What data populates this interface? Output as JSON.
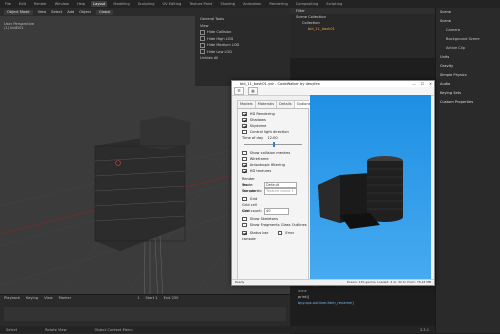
{
  "topbar": {
    "tabs": [
      "File",
      "Edit",
      "Render",
      "Window",
      "Help",
      "Layout",
      "Modeling",
      "Sculpting",
      "UV Editing",
      "Texture Paint",
      "Shading",
      "Animation",
      "Rendering",
      "Compositing",
      "Scripting"
    ],
    "active_index": 5
  },
  "viewport_header": {
    "mode": "Object Mode",
    "view": "View",
    "select": "Select",
    "add": "Add",
    "object": "Object",
    "global": "Global"
  },
  "viewport": {
    "label": "User Perspective",
    "sublabel": "(1) bldEl01"
  },
  "npanel": {
    "rows": [
      "General Tools",
      "View",
      "Hide Collision",
      "Hide High LOD",
      "Hide Medium LOD",
      "Hide Low LOD",
      "Unhide All"
    ]
  },
  "outliner": {
    "search_placeholder": "Filter",
    "rows": [
      "Scene Collection",
      "Collection",
      "bld_11_bash01"
    ]
  },
  "properties": {
    "sections": [
      "Scene",
      "Scene"
    ],
    "rows": [
      "Camera",
      "Background Scene",
      "Active Clip",
      "Units",
      "Gravity",
      "Simple Physics",
      "Audio",
      "Keying Sets",
      "Custom Properties"
    ]
  },
  "timeline": {
    "playback": "Playback",
    "keying": "Keying",
    "view": "View",
    "marker": "Marker",
    "frame": "1",
    "start": "Start 1",
    "end": "End 250"
  },
  "console": {
    "lines": [
      "lead = bpy.context.object",
      ">>> ",
      "print()",
      "bpy.ops.outliner.item_rename()"
    ]
  },
  "statusbar": {
    "items": [
      "Select",
      "Rotate View",
      "Object Context Menu",
      "3.3.1"
    ]
  },
  "window": {
    "title": "bld_11_bash01.ydr - CodeWalker by dexyfex",
    "controls": [
      "—",
      "☐",
      "✕"
    ],
    "toolbar": [
      "☰",
      "▦"
    ],
    "tabs": [
      "Models",
      "Materials",
      "Details",
      "Options"
    ],
    "active_tab": "Options",
    "options": {
      "hd_rendering": {
        "label": "HD Rendering",
        "checked": true
      },
      "shadows": {
        "label": "Shadows",
        "checked": true
      },
      "skydome": {
        "label": "Skydome",
        "checked": true
      },
      "control_light_direction": {
        "label": "Control light direction",
        "checked": false
      },
      "time_of_day_label": "Time of day",
      "time_of_day_value": "12:00",
      "time_of_day_fraction": 0.5,
      "show_collision_meshes": {
        "label": "Show collision meshes",
        "checked": false
      },
      "wireframe": {
        "label": "Wireframe",
        "checked": false
      },
      "anisotropic_filtering": {
        "label": "Anisotropic filtering",
        "checked": true
      },
      "hd_textures": {
        "label": "HD textures",
        "checked": true
      },
      "render_mode_label": "Render mode:",
      "render_mode_value": "Default",
      "tex_sampler_label": "Tex sampler:",
      "tex_sampler_value": "DiffuseSampler",
      "tex_coords_label": "Tex coords:",
      "tex_coords_value": "Texture coord 1",
      "grid": {
        "label": "Grid",
        "checked": false
      },
      "grid_size_label": "Grid cell size:",
      "grid_size_value": "10",
      "grid_count_label": "Grid count:",
      "grid_count_value": "40",
      "show_skeletons": {
        "label": "Show Skeletons",
        "checked": false
      },
      "show_fragments": {
        "label": "Show Fragments Glass Outlines",
        "checked": false
      },
      "status_bar": {
        "label": "Status bar",
        "checked": true
      },
      "error_console": {
        "label": "Error console",
        "checked": false
      }
    },
    "status_left": "Ready",
    "status_right": "Drawn: 130 geoms, Loaded: 4 dr, 32 tx  Vram: 76.43 MB"
  },
  "colors": {
    "sky_top": "#1d8fe3",
    "sky_bottom": "#47aaf0",
    "blender_bg": "#3b3b3b"
  }
}
